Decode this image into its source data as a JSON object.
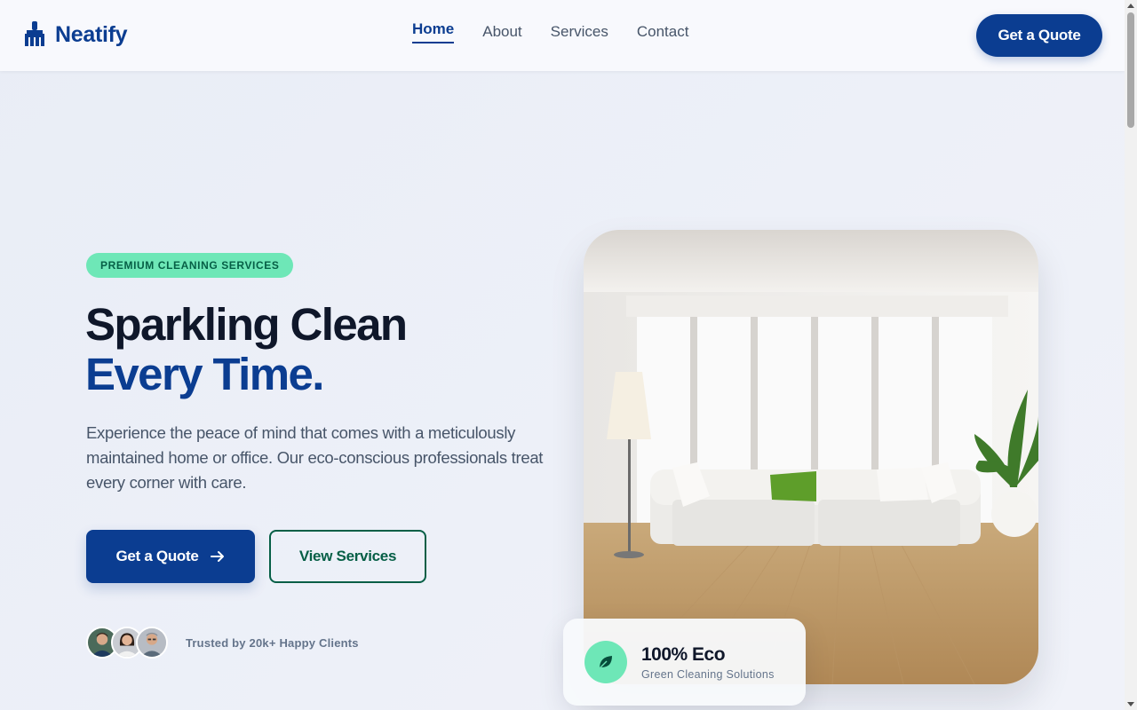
{
  "brand": {
    "name": "Neatify",
    "icon": "broom-icon",
    "color": "#0b3d91"
  },
  "nav": {
    "items": [
      {
        "label": "Home",
        "active": true
      },
      {
        "label": "About",
        "active": false
      },
      {
        "label": "Services",
        "active": false
      },
      {
        "label": "Contact",
        "active": false
      }
    ],
    "cta_label": "Get a Quote"
  },
  "hero": {
    "badge": "PREMIUM CLEANING SERVICES",
    "headline_line1": "Sparkling Clean",
    "headline_line2": "Every Time.",
    "description": "Experience the peace of mind that comes with a meticulously maintained home or office. Our eco-conscious professionals treat every corner with care.",
    "primary_button": "Get a Quote",
    "primary_button_icon": "arrow-right-icon",
    "secondary_button": "View Services",
    "trust_text": "Trusted by 20k+ Happy Clients",
    "image_icon": "living-room-photo"
  },
  "eco_card": {
    "title": "100% Eco",
    "subtitle": "Green Cleaning Solutions",
    "icon": "leaf-icon"
  },
  "colors": {
    "primary": "#0b3d91",
    "accent": "#6ee7b7",
    "accent_dark": "#065f46"
  }
}
